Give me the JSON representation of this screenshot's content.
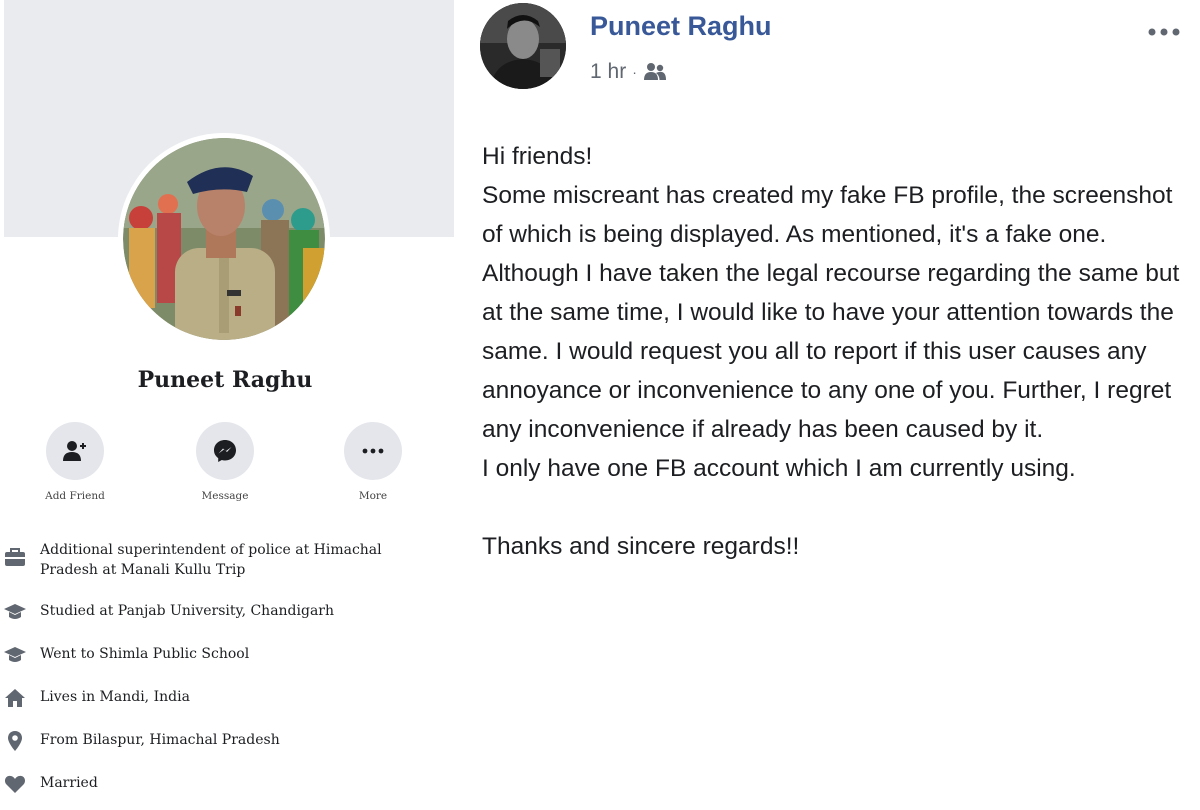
{
  "profile": {
    "name": "Puneet Raghu",
    "actions": [
      {
        "label": "Add Friend",
        "icon": "add-friend-icon"
      },
      {
        "label": "Message",
        "icon": "messenger-icon"
      },
      {
        "label": "More",
        "icon": "more-icon"
      }
    ],
    "intro": [
      {
        "icon": "briefcase-icon",
        "text": "Additional superintendent of police at Himachal Pradesh at Manali Kullu Trip"
      },
      {
        "icon": "graduation-cap-icon",
        "text": "Studied at Panjab University, Chandigarh"
      },
      {
        "icon": "graduation-cap-icon",
        "text": "Went to Shimla Public School"
      },
      {
        "icon": "home-icon",
        "text": "Lives in Mandi, India"
      },
      {
        "icon": "location-pin-icon",
        "text": "From Bilaspur, Himachal Pradesh"
      },
      {
        "icon": "heart-icon",
        "text": "Married"
      }
    ]
  },
  "post": {
    "author": "Puneet Raghu",
    "time": "1 hr",
    "audience_icon": "friends-icon",
    "menu_icon": "more-dots-icon",
    "body": [
      "Hi friends!",
      "Some miscreant has created my fake FB profile, the screenshot of which is being displayed. As mentioned, it's a fake one. Although I have taken the legal recourse regarding the same but at the same time, I would like to have your attention towards the same. I would request you all to report if this user causes any annoyance or inconvenience to any one of you. Further, I regret any inconvenience if already has been caused by it.",
      "I only have one FB account which I am currently using.",
      "Thanks and sincere regards!!"
    ]
  },
  "colors": {
    "author_link": "#385898",
    "cover_bg": "#e9ebee",
    "action_circle": "#e4e6eb",
    "icon_gray": "#606770"
  }
}
